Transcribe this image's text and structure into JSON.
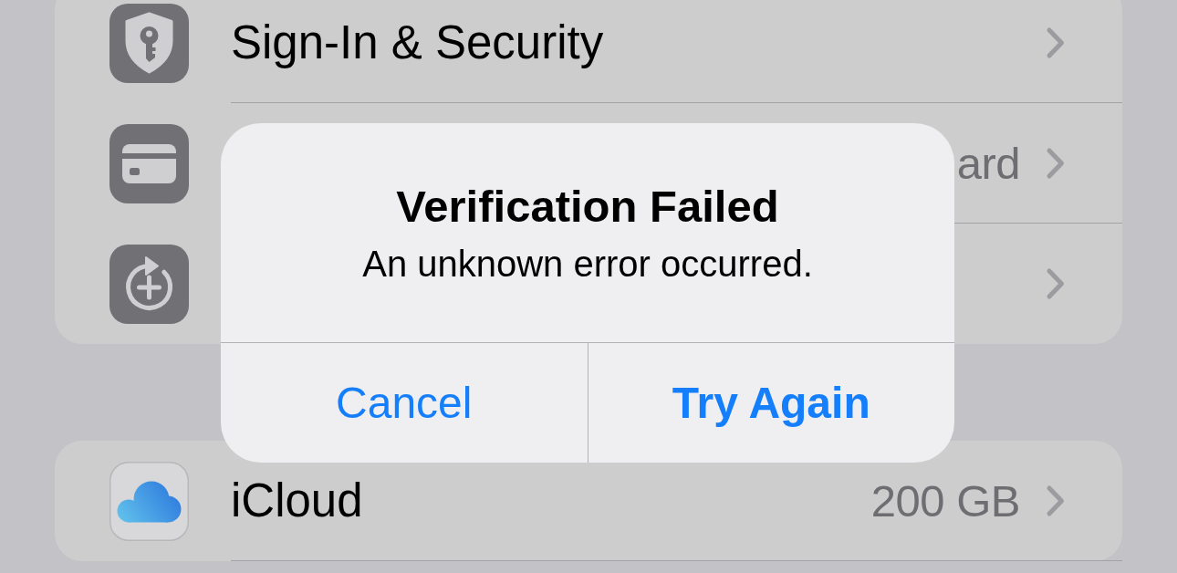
{
  "sections": [
    {
      "rows": [
        {
          "label": "Sign-In & Security",
          "chevron": true
        },
        {
          "value": "ard",
          "chevron": true
        },
        {
          "chevron": true
        }
      ]
    },
    {
      "rows": [
        {
          "label": "iCloud",
          "value": "200 GB",
          "chevron": true
        }
      ]
    }
  ],
  "dialog": {
    "title": "Verification Failed",
    "message": "An unknown error occurred.",
    "buttons": [
      {
        "label": "Cancel",
        "emphasized": false
      },
      {
        "label": "Try Again",
        "emphasized": true
      }
    ]
  }
}
